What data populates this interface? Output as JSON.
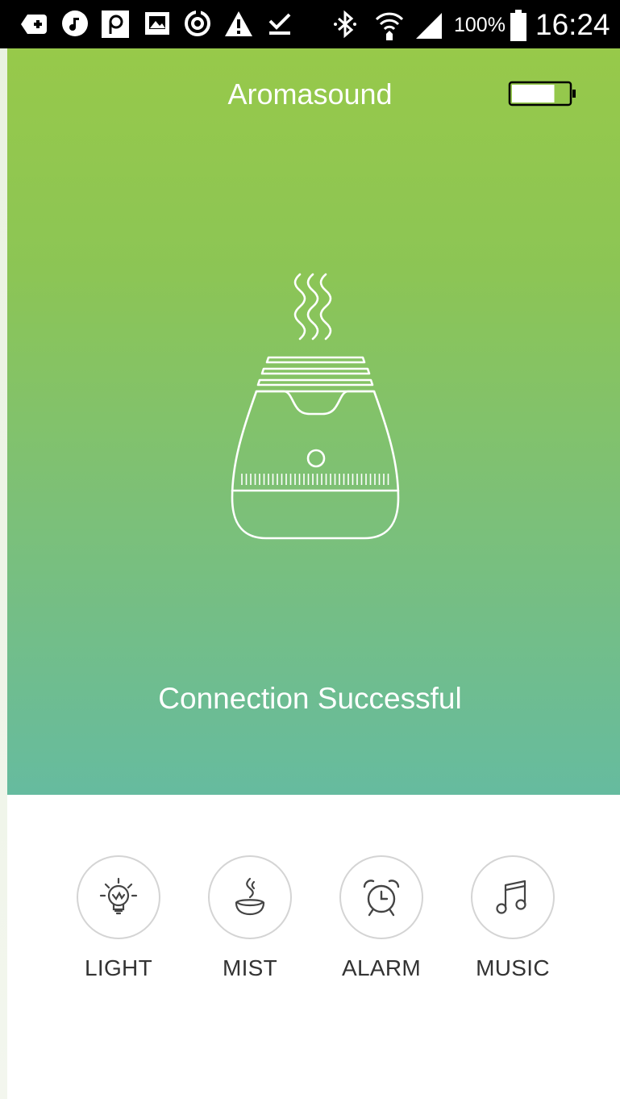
{
  "status_bar": {
    "battery_percent": "100%",
    "time": "16:24",
    "icons": [
      "add-box-icon",
      "music-note-icon",
      "parking-icon",
      "gallery-icon",
      "sync-icon",
      "warning-icon",
      "download-done-icon",
      "bluetooth-icon",
      "wifi-icon",
      "signal-icon",
      "battery-icon"
    ]
  },
  "header": {
    "title": "Aromasound",
    "battery_level": 0.75
  },
  "device": {
    "status": "Connection Successful"
  },
  "nav": {
    "items": [
      {
        "label": "LIGHT",
        "icon": "light-bulb-icon"
      },
      {
        "label": "MIST",
        "icon": "mist-icon"
      },
      {
        "label": "ALARM",
        "icon": "alarm-clock-icon"
      },
      {
        "label": "MUSIC",
        "icon": "music-icon"
      }
    ]
  },
  "colors": {
    "gradient_top": "#97c94a",
    "gradient_bottom": "#66bb9f",
    "nav_label": "#333333",
    "circle_border": "#d4d4d4"
  }
}
